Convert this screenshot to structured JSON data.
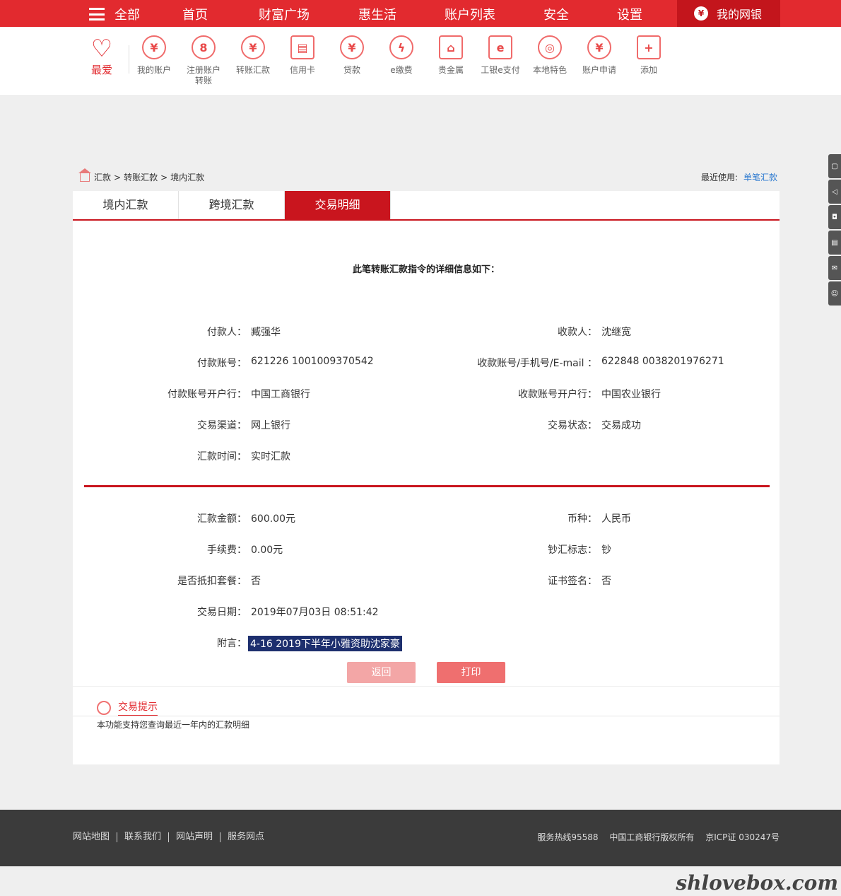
{
  "topnav": {
    "all": "全部",
    "items": [
      "首页",
      "财富广场",
      "惠生活",
      "账户列表",
      "安全",
      "设置"
    ],
    "mybank": "我的网银"
  },
  "quick": {
    "fav": "最爱",
    "items": [
      {
        "label": "我的账户",
        "icon": "¥"
      },
      {
        "label": "注册账户转账",
        "icon": "8"
      },
      {
        "label": "转账汇款",
        "icon": "¥"
      },
      {
        "label": "信用卡",
        "icon": "▤"
      },
      {
        "label": "贷款",
        "icon": "¥"
      },
      {
        "label": "e缴费",
        "icon": "ϟ"
      },
      {
        "label": "贵金属",
        "icon": "⌂"
      },
      {
        "label": "工银e支付",
        "icon": "e"
      },
      {
        "label": "本地特色",
        "icon": "◎"
      },
      {
        "label": "账户申请",
        "icon": "¥"
      },
      {
        "label": "添加",
        "icon": "+"
      }
    ]
  },
  "breadcrumb": {
    "items": [
      "汇款",
      "转账汇款",
      "境内汇款"
    ],
    "sep": ">",
    "recent_label": "最近使用:",
    "recent_link": "单笔汇款"
  },
  "tabs": [
    "境内汇款",
    "跨境汇款",
    "交易明细"
  ],
  "detail": {
    "headline": "此笔转账汇款指令的详细信息如下：",
    "left1": [
      {
        "label": "付款人：",
        "value": "臧强华"
      },
      {
        "label": "付款账号：",
        "value": "621226 1001009370542"
      },
      {
        "label": "付款账号开户行：",
        "value": "中国工商银行"
      },
      {
        "label": "交易渠道：",
        "value": "网上银行"
      },
      {
        "label": "汇款时间：",
        "value": "实时汇款"
      }
    ],
    "right1": [
      {
        "label": "收款人：",
        "value": "沈继宽"
      },
      {
        "label": "收款账号/手机号/E-mail ：",
        "value": "622848 0038201976271"
      },
      {
        "label": "收款账号开户行：",
        "value": "中国农业银行"
      },
      {
        "label": "交易状态：",
        "value": "交易成功"
      }
    ],
    "left2": [
      {
        "label": "汇款金额：",
        "value": "600.00元"
      },
      {
        "label": "手续费：",
        "value": "0.00元"
      },
      {
        "label": "是否抵扣套餐：",
        "value": "否"
      },
      {
        "label": "交易日期：",
        "value": "2019年07月03日 08:51:42"
      },
      {
        "label": "附言：",
        "value": "4-16 2019下半年小雅资助沈家豪"
      }
    ],
    "right2": [
      {
        "label": "币种：",
        "value": "人民币"
      },
      {
        "label": "钞汇标志：",
        "value": "钞"
      },
      {
        "label": "证书签名：",
        "value": "否"
      }
    ],
    "btn_back": "返回",
    "btn_print": "打印"
  },
  "tips": {
    "title": "交易提示",
    "text": "本功能支持您查询最近一年内的汇款明细"
  },
  "footer": {
    "links": [
      "网站地图",
      "联系我们",
      "网站声明",
      "服务网点"
    ],
    "hotline": "服务热线95588",
    "copyright": "中国工商银行版权所有",
    "icp": "京ICP证 030247号"
  },
  "watermark": "shlovebox.com"
}
